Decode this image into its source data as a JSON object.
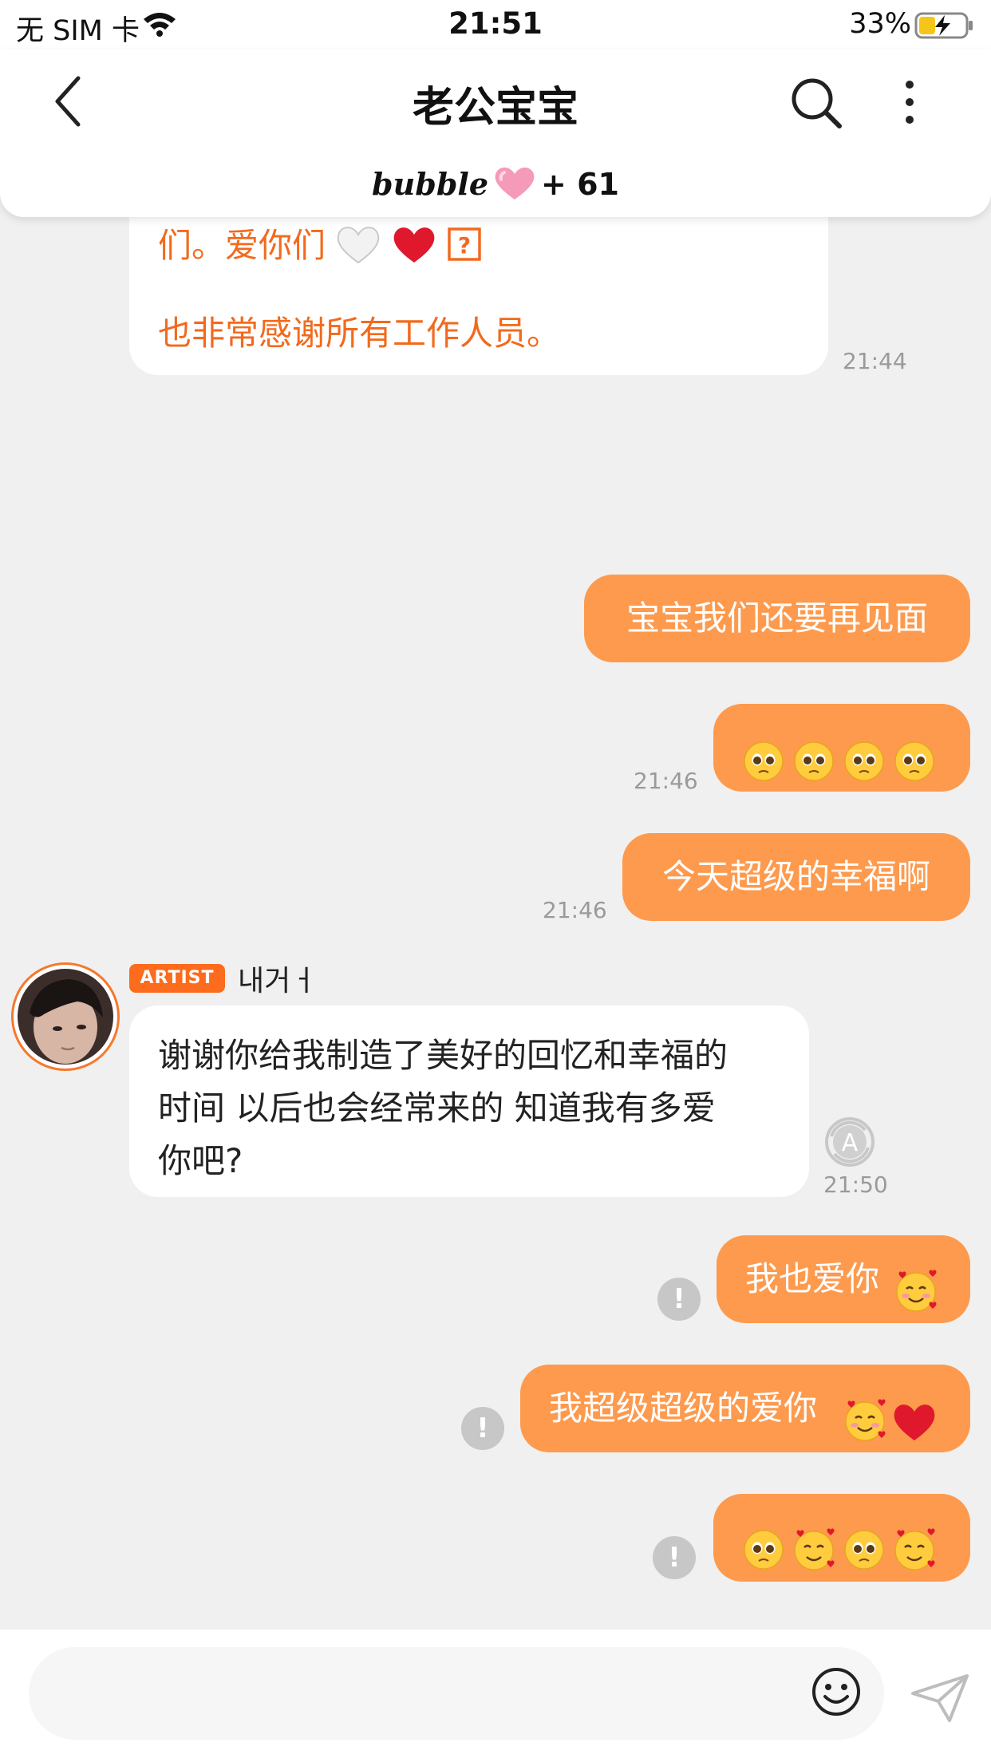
{
  "status_bar": {
    "carrier": "无 SIM 卡",
    "time": "21:51",
    "battery": "33%"
  },
  "header": {
    "title": "老公宝宝",
    "bubble_label": "bubble",
    "bubble_count": "+ 61"
  },
  "messages": {
    "prev_artist_line1": "们。爱你们",
    "prev_artist_line2": "也非常感谢所有工作人员。",
    "prev_artist_time": "21:44",
    "me1": "宝宝我们还要再见面",
    "me2_time": "21:46",
    "me3": "今天超级的幸福啊",
    "me3_time": "21:46",
    "artist_tag": "ARTIST",
    "artist_name": "내거ㅓ",
    "artist_msg_line1": "谢谢你给我制造了美好的回忆和幸福的",
    "artist_msg_line2": "时间 以后也会经常来的 知道我有多爱",
    "artist_msg_line3": "你吧?",
    "artist_msg_time": "21:50",
    "me4": "我也爱你",
    "me5": "我超级超级的爱你",
    "alert_glyph": "!"
  },
  "colors": {
    "my_bubble": "#fe9a4d",
    "artist_text_highlight": "#f26a1d",
    "artist_tag_bg": "#fd6b1c",
    "background": "#f0f0f0"
  }
}
